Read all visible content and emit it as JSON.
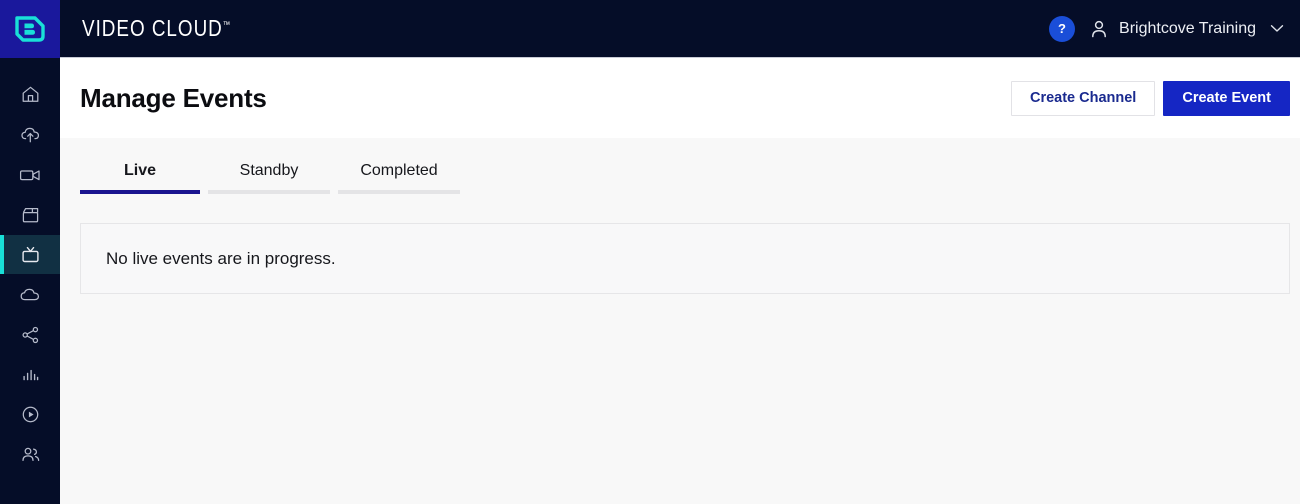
{
  "header": {
    "logo_icon": "brightcove-b-logo",
    "product_name": "VIDEO CLOUD",
    "trademark": "™",
    "help_label": "?",
    "help_icon": "question-mark-icon",
    "account_icon": "person-icon",
    "account_name": "Brightcove Training",
    "account_chevron_icon": "chevron-down-icon"
  },
  "sidebar": {
    "items": [
      {
        "icon": "home-icon",
        "name": "home",
        "active": false
      },
      {
        "icon": "cloud-upload-icon",
        "name": "upload",
        "active": false
      },
      {
        "icon": "video-camera-icon",
        "name": "media",
        "active": false
      },
      {
        "icon": "clapboard-icon",
        "name": "studio",
        "active": false
      },
      {
        "icon": "television-icon",
        "name": "live",
        "active": true
      },
      {
        "icon": "cloud-icon",
        "name": "cloud-playout",
        "active": false
      },
      {
        "icon": "share-network-icon",
        "name": "social",
        "active": false
      },
      {
        "icon": "bar-chart-icon",
        "name": "analytics",
        "active": false
      },
      {
        "icon": "play-circle-icon",
        "name": "players",
        "active": false
      },
      {
        "icon": "people-icon",
        "name": "audience",
        "active": false
      }
    ]
  },
  "page": {
    "title": "Manage Events",
    "actions": {
      "create_channel_label": "Create Channel",
      "create_event_label": "Create Event"
    }
  },
  "tabs": [
    {
      "label": "Live",
      "active": true
    },
    {
      "label": "Standby",
      "active": false
    },
    {
      "label": "Completed",
      "active": false
    }
  ],
  "content": {
    "empty_message": "No live events are in progress."
  },
  "colors": {
    "header_background": "#050d28",
    "logo_tile": "#1a189c",
    "logo_mark": "#19e0d8",
    "accent_cyan": "#19e0d8",
    "primary_button": "#1526c4",
    "secondary_button_text": "#1a2a8f",
    "help_button": "#1a4ed8",
    "active_tab_underline": "#1a148f",
    "inactive_tab_underline": "#e4e4e6",
    "page_background": "#f8f8f8",
    "panel_background": "#f8f8f9",
    "panel_border": "#e6e6e8",
    "active_nav_background": "#113043"
  }
}
